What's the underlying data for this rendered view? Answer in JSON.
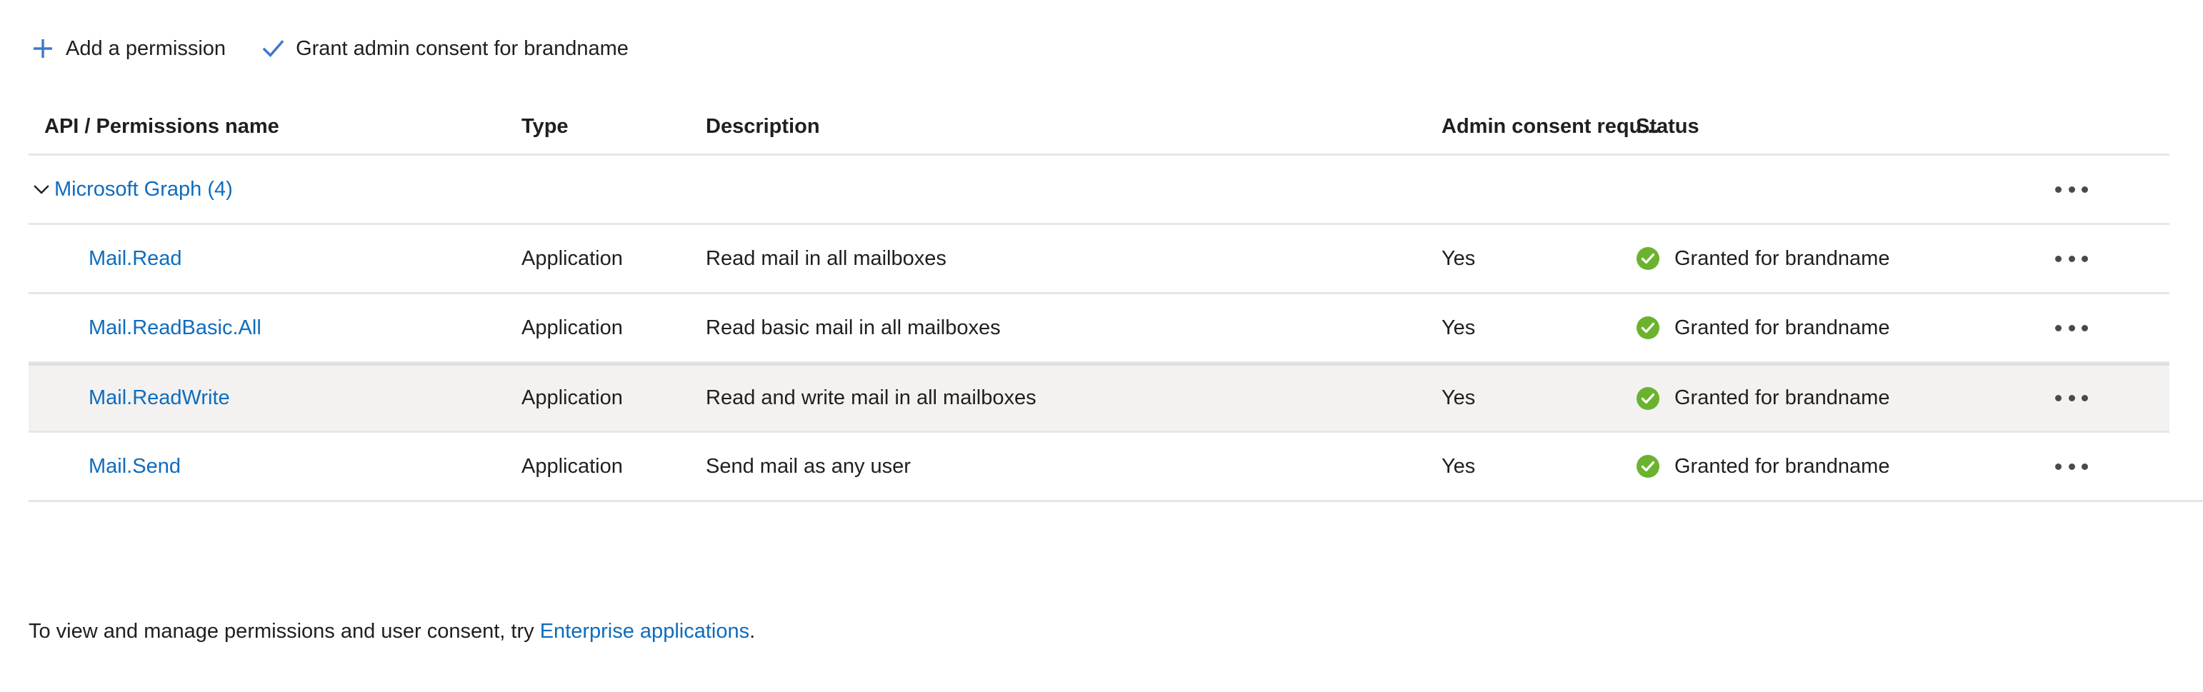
{
  "toolbar": {
    "add_permission_label": "Add a permission",
    "add_permission_icon": "plus-icon",
    "grant_consent_label": "Grant admin consent for brandname",
    "grant_consent_icon": "checkmark-icon"
  },
  "table": {
    "headers": {
      "name": "API / Permissions name",
      "type": "Type",
      "description": "Description",
      "admin_consent": "Admin consent requ...",
      "status": "Status"
    },
    "group": {
      "label": "Microsoft Graph (4)",
      "expanded": true,
      "chevron_icon": "chevron-down-icon",
      "overflow_icon": "ellipsis-icon"
    },
    "rows": [
      {
        "name": "Mail.Read",
        "type": "Application",
        "description": "Read mail in all mailboxes",
        "admin_consent": "Yes",
        "status": "Granted for brandname",
        "status_icon": "check-circle-icon",
        "overflow_icon": "ellipsis-icon",
        "highlighted": false
      },
      {
        "name": "Mail.ReadBasic.All",
        "type": "Application",
        "description": "Read basic mail in all mailboxes",
        "admin_consent": "Yes",
        "status": "Granted for brandname",
        "status_icon": "check-circle-icon",
        "overflow_icon": "ellipsis-icon",
        "highlighted": false
      },
      {
        "name": "Mail.ReadWrite",
        "type": "Application",
        "description": "Read and write mail in all mailboxes",
        "admin_consent": "Yes",
        "status": "Granted for brandname",
        "status_icon": "check-circle-icon",
        "overflow_icon": "ellipsis-icon",
        "highlighted": true
      },
      {
        "name": "Mail.Send",
        "type": "Application",
        "description": "Send mail as any user",
        "admin_consent": "Yes",
        "status": "Granted for brandname",
        "status_icon": "check-circle-icon",
        "overflow_icon": "ellipsis-icon",
        "highlighted": false
      }
    ]
  },
  "footer": {
    "text_before": "To view and manage permissions and user consent, try ",
    "link_label": "Enterprise applications",
    "text_after": "."
  },
  "colors": {
    "link_blue": "#0f6cbd",
    "icon_blue": "#3a78d0",
    "status_green": "#6bb22e",
    "row_highlight": "#f3f2f1",
    "border": "#e6e6e6",
    "text": "#201f1e"
  }
}
